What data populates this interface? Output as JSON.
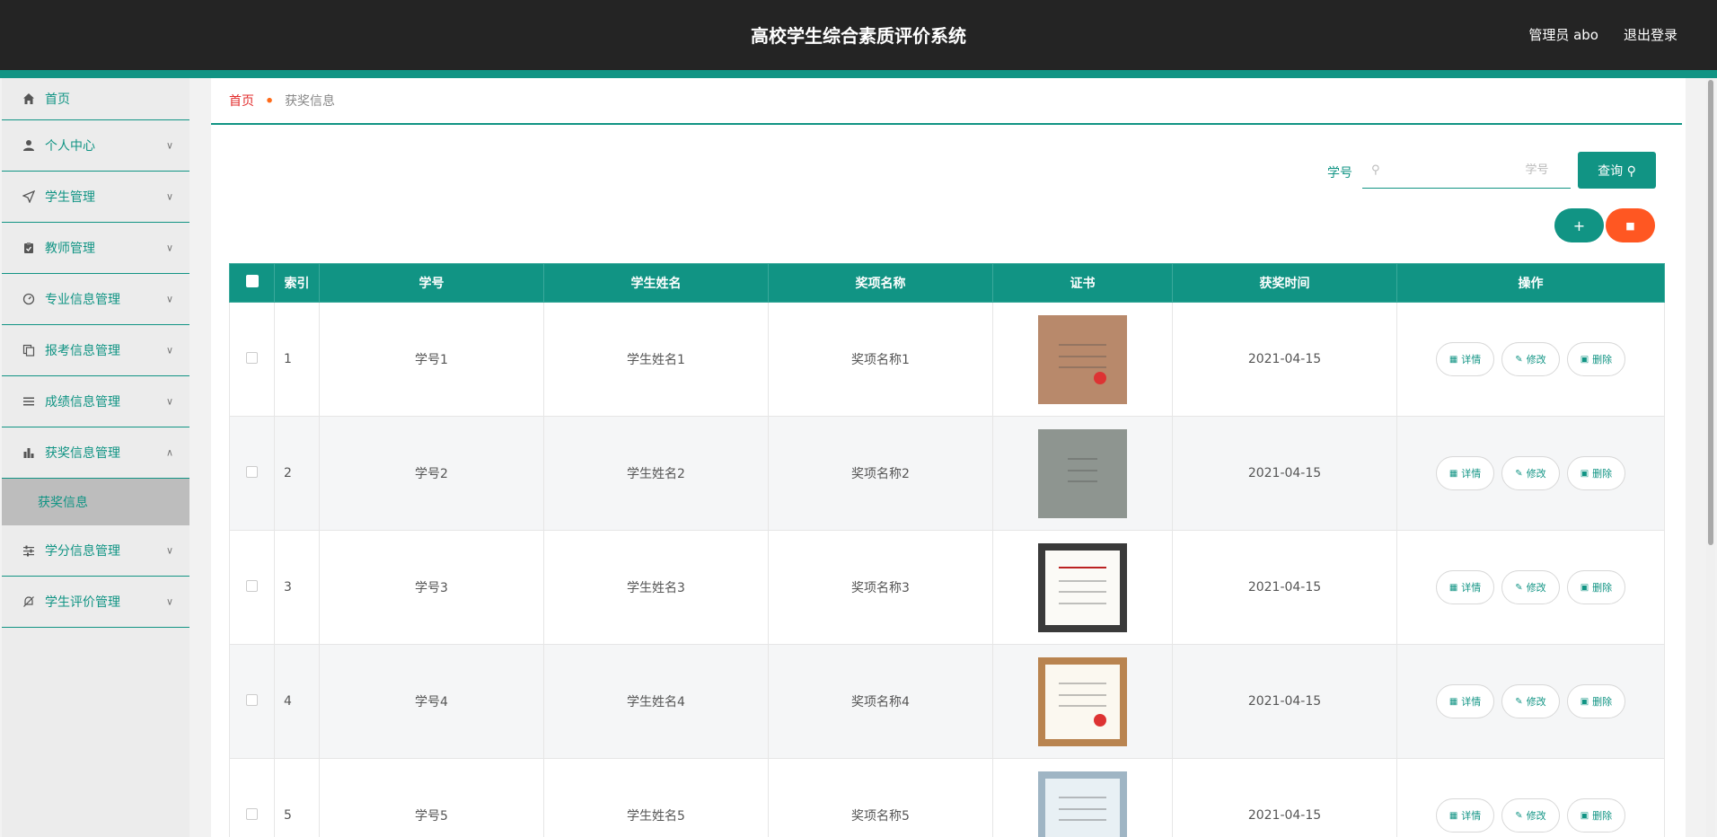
{
  "header": {
    "title": "高校学生综合素质评价系统",
    "admin": "管理员 abo",
    "logout": "退出登录"
  },
  "sidebar": {
    "items": [
      {
        "label": "首页",
        "icon": "home-icon"
      },
      {
        "label": "个人中心",
        "icon": "user-icon"
      },
      {
        "label": "学生管理",
        "icon": "navigation-icon"
      },
      {
        "label": "教师管理",
        "icon": "clipboard-icon"
      },
      {
        "label": "专业信息管理",
        "icon": "dashboard-icon"
      },
      {
        "label": "报考信息管理",
        "icon": "copy-icon"
      },
      {
        "label": "成绩信息管理",
        "icon": "list-icon"
      },
      {
        "label": "获奖信息管理",
        "icon": "bar-chart-icon"
      },
      {
        "label": "学分信息管理",
        "icon": "sliders-icon"
      },
      {
        "label": "学生评价管理",
        "icon": "bell-off-icon"
      }
    ],
    "active_sub": "获奖信息"
  },
  "breadcrumb": {
    "home": "首页",
    "current": "获奖信息"
  },
  "search": {
    "label": "学号",
    "placeholder": "学号",
    "button": "查询"
  },
  "table": {
    "headers": [
      "索引",
      "学号",
      "学生姓名",
      "奖项名称",
      "证书",
      "获奖时间",
      "操作"
    ],
    "actions": {
      "detail": "详情",
      "edit": "修改",
      "delete": "删除"
    },
    "rows": [
      {
        "index": "1",
        "student_no": "学号1",
        "name": "学生姓名1",
        "award": "奖项名称1",
        "date": "2021-04-15",
        "cert_color": "#b8896b"
      },
      {
        "index": "2",
        "student_no": "学号2",
        "name": "学生姓名2",
        "award": "奖项名称2",
        "date": "2021-04-15",
        "cert_color": "#8e9590"
      },
      {
        "index": "3",
        "student_no": "学号3",
        "name": "学生姓名3",
        "award": "奖项名称3",
        "date": "2021-04-15",
        "cert_color": "#3a3a3a"
      },
      {
        "index": "4",
        "student_no": "学号4",
        "name": "学生姓名4",
        "award": "奖项名称4",
        "date": "2021-04-15",
        "cert_color": "#b98450"
      },
      {
        "index": "5",
        "student_no": "学号5",
        "name": "学生姓名5",
        "award": "奖项名称5",
        "date": "2021-04-15",
        "cert_color": "#9fb5c4"
      }
    ]
  }
}
